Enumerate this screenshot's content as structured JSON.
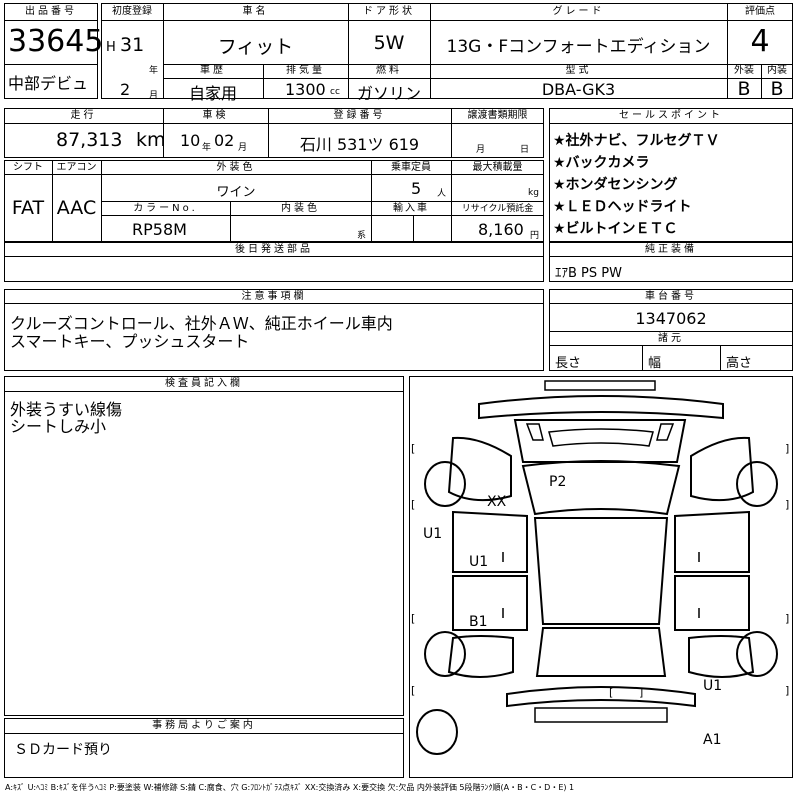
{
  "header": {
    "lot_label": "出品番号",
    "lot_no": "33645",
    "first_reg_label": "初度登録",
    "era": "H",
    "year": "31",
    "year_unit": "年",
    "month": "2",
    "month_unit": "月",
    "car_name_label": "車名",
    "car_name": "フィット",
    "door_label": "ドア形状",
    "door": "5W",
    "grade_label": "グレード",
    "grade": "13G・Fコンフォートエディション",
    "score_label": "評価点",
    "score": "4",
    "venue": "中部デビュ",
    "history_label": "車歴",
    "history": "自家用",
    "displacement_label": "排気量",
    "displacement": "1300",
    "displacement_unit": "cc",
    "fuel_label": "燃料",
    "fuel": "ガソリン",
    "model_label": "型式",
    "model": "DBA-GK3",
    "ext_label": "外装",
    "ext_grade": "B",
    "int_label": "内装",
    "int_grade": "B"
  },
  "row2": {
    "mileage_label": "走行",
    "mileage": "87,313",
    "mileage_unit": "km",
    "inspection_label": "車検",
    "insp_year": "10",
    "insp_year_unit": "年",
    "insp_month": "02",
    "insp_month_unit": "月",
    "plate_label": "登録番号",
    "plate": "石川 531ツ 619",
    "transfer_label": "譲渡書類期限",
    "transfer_month_unit": "月",
    "transfer_day_unit": "日"
  },
  "specs": {
    "shift_label": "シフト",
    "shift": "FAT",
    "ac_label": "エアコン",
    "ac": "AAC",
    "ext_color_label": "外装色",
    "ext_color": "ワイン",
    "capacity_label": "乗車定員",
    "capacity": "5",
    "capacity_unit": "人",
    "load_label": "最大積載量",
    "load_unit": "kg",
    "color_no_label": "カラーNo.",
    "color_no": "RP58M",
    "int_color_label": "内装色",
    "int_color_unit": "系",
    "import_label": "輸入車",
    "recycle_label": "リサイクル預託金",
    "recycle": "8,160",
    "recycle_unit": "円"
  },
  "sales_points": {
    "label": "セールスポイント",
    "items": [
      "★社外ナビ、フルセグＴＶ",
      "★バックカメラ",
      "★ホンダセンシング",
      "★ＬＥＤヘッドライト",
      "★ビルトインＥＴＣ"
    ]
  },
  "later_parts_label": "後日発送部品",
  "equipment": {
    "label": "純正装備",
    "value": "ｴｱB PS PW"
  },
  "notes": {
    "label": "注意事項欄",
    "lines": [
      "クルーズコントロール、社外ＡＷ、純正ホイール車内",
      "スマートキー、プッシュスタート"
    ]
  },
  "chassis": {
    "label": "車台番号",
    "value": "1347062"
  },
  "dims": {
    "label": "諸元",
    "length": "長さ",
    "width": "幅",
    "height": "高さ"
  },
  "inspector": {
    "label": "検査員記入欄",
    "lines": [
      "外装うすい線傷",
      "シートしみ小"
    ]
  },
  "office": {
    "label": "事務局よりご案内",
    "value": "ＳＤカード預り"
  },
  "diagram": {
    "marks": [
      "XX",
      "P2",
      "U1",
      "U1",
      "B1",
      "U1",
      "A1"
    ],
    "brackets": [
      "[",
      "]",
      "[",
      "]",
      "[",
      "]",
      "[",
      "]",
      "[",
      "]"
    ]
  },
  "legend": "A:ｷｽﾞ U:ﾍｺﾐ B:ｷｽﾞを伴うﾍｺﾐ P:要塗装 W:補修跡 S:錆 C:腐食、穴 G:ﾌﾛﾝﾄｶﾞﾗｽ点ｷｽﾞ XX:交換済み X:要交換 欠:欠品 内外装評価 5段階ﾗﾝｸ順(A・B・C・D・E) 1"
}
